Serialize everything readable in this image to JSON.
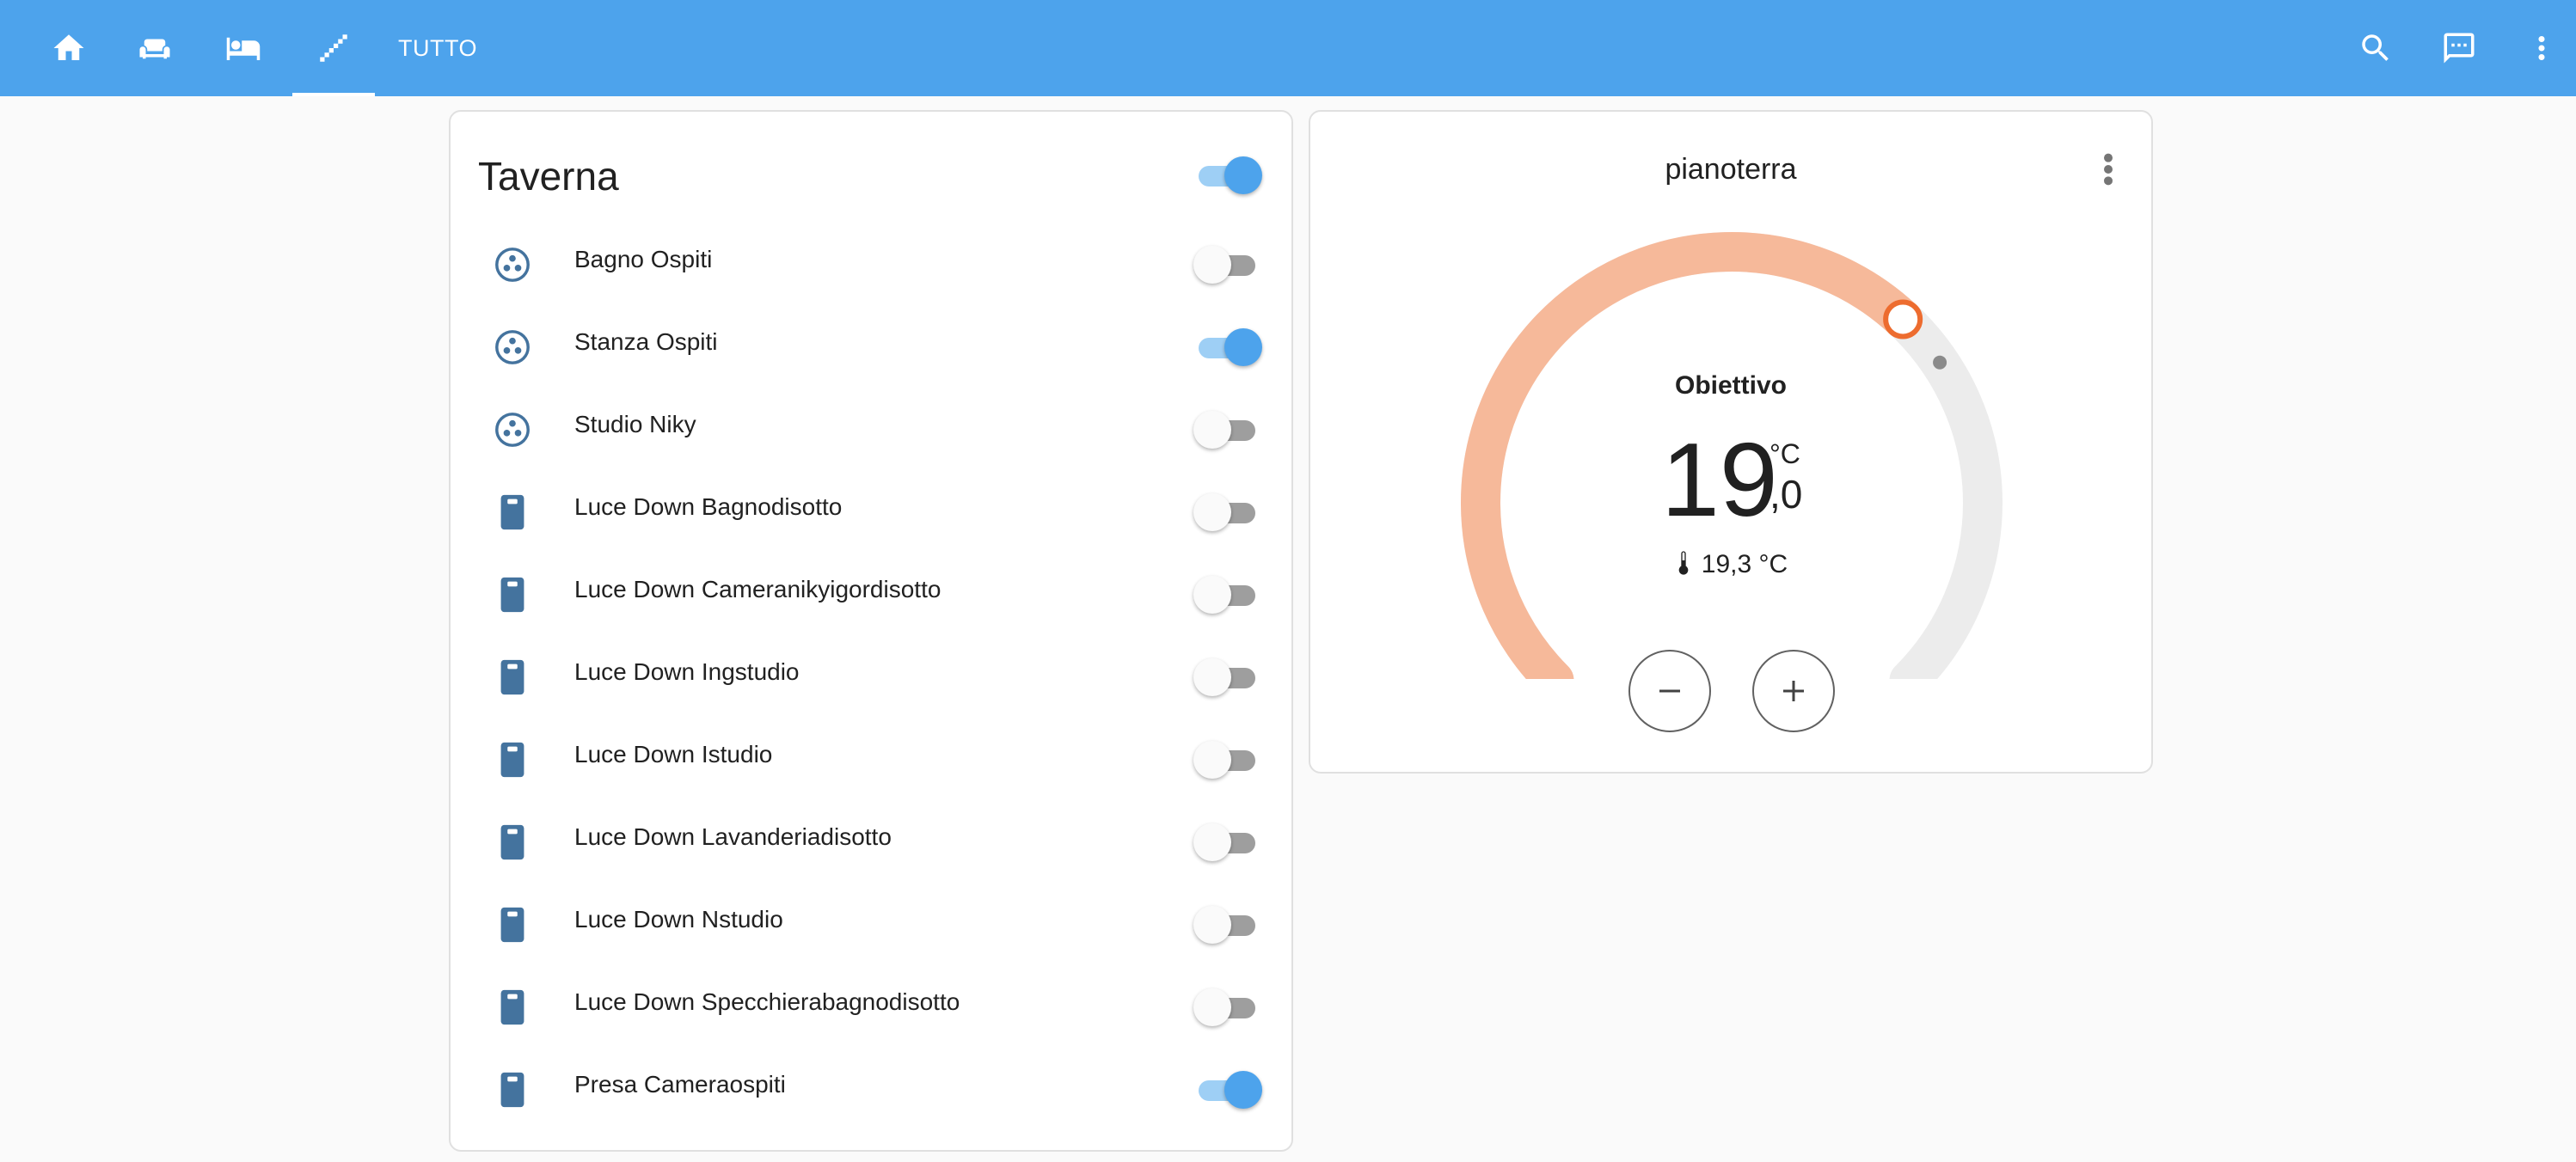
{
  "topbar": {
    "background": "#4da3ec",
    "tabs": [
      {
        "icon": "home-icon"
      },
      {
        "icon": "sofa-icon"
      },
      {
        "icon": "bed-icon"
      },
      {
        "icon": "stairs-icon",
        "active": true
      },
      {
        "label": "TUTTO"
      }
    ],
    "actions": [
      "search-icon",
      "chat-icon",
      "more-vertical-icon"
    ]
  },
  "entities_card": {
    "title": "Taverna",
    "master_toggle": true,
    "rows": [
      {
        "label": "Bagno Ospiti",
        "icon": "fan-icon",
        "on": false
      },
      {
        "label": "Stanza Ospiti",
        "icon": "fan-icon",
        "on": true
      },
      {
        "label": "Studio Niky",
        "icon": "fan-icon",
        "on": false
      },
      {
        "label": "Luce Down Bagnodisotto",
        "icon": "switch-icon",
        "on": false
      },
      {
        "label": "Luce Down Cameranikyigordisotto",
        "icon": "switch-icon",
        "on": false
      },
      {
        "label": "Luce Down Ingstudio",
        "icon": "switch-icon",
        "on": false
      },
      {
        "label": "Luce Down Istudio",
        "icon": "switch-icon",
        "on": false
      },
      {
        "label": "Luce Down Lavanderiadisotto",
        "icon": "switch-icon",
        "on": false
      },
      {
        "label": "Luce Down Nstudio",
        "icon": "switch-icon",
        "on": false
      },
      {
        "label": "Luce Down Specchierabagnodisotto",
        "icon": "switch-icon",
        "on": false
      },
      {
        "label": "Presa Cameraospiti",
        "icon": "switch-icon",
        "on": true
      }
    ],
    "icon_color": "#44739e"
  },
  "thermostat": {
    "name": "pianoterra",
    "mode_label": "Obiettivo",
    "target_integer": "19",
    "target_unit": "°C",
    "target_decimal": ",0",
    "current_temp": "19,3 °C",
    "heat_color": "#f6b99a",
    "handle_color": "#ed6c2f"
  }
}
